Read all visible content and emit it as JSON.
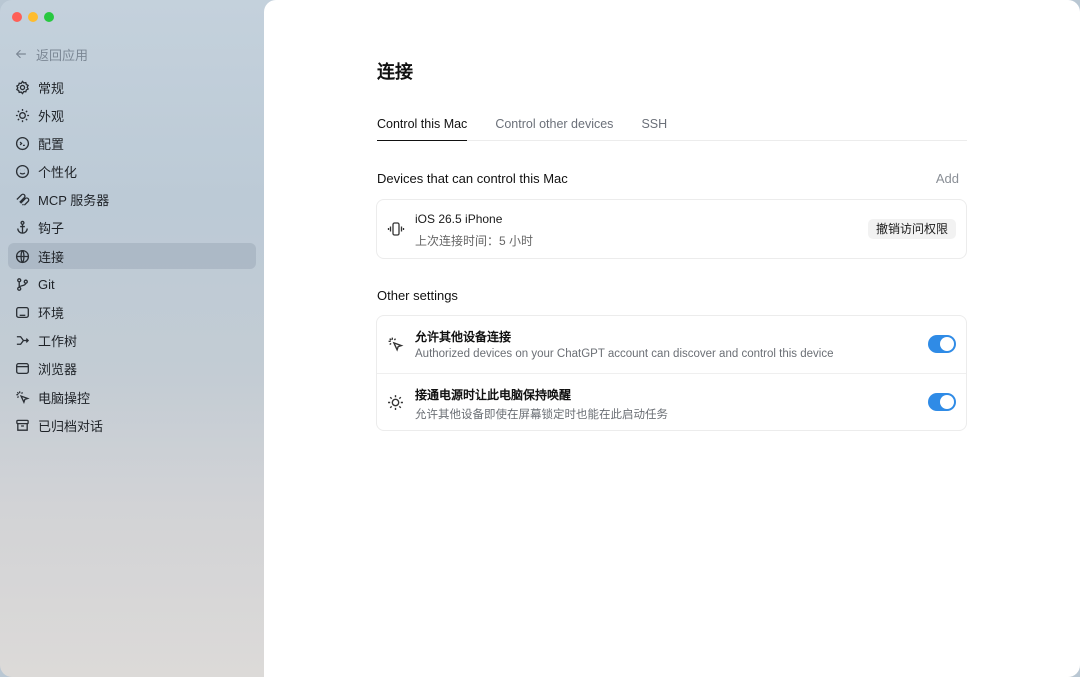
{
  "sidebar": {
    "back_label": "返回应用",
    "items": [
      {
        "label": "常规",
        "icon": "gear-icon"
      },
      {
        "label": "外观",
        "icon": "sun-icon"
      },
      {
        "label": "配置",
        "icon": "config-icon"
      },
      {
        "label": "个性化",
        "icon": "smiley-icon"
      },
      {
        "label": "MCP 服务器",
        "icon": "mcp-icon"
      },
      {
        "label": "钩子",
        "icon": "anchor-icon"
      },
      {
        "label": "连接",
        "icon": "globe-icon",
        "active": true
      },
      {
        "label": "Git",
        "icon": "git-branch-icon"
      },
      {
        "label": "环境",
        "icon": "terminal-icon"
      },
      {
        "label": "工作树",
        "icon": "worktree-icon"
      },
      {
        "label": "浏览器",
        "icon": "browser-icon"
      },
      {
        "label": "电脑操控",
        "icon": "cursor-click-icon"
      },
      {
        "label": "已归档对话",
        "icon": "archive-icon"
      }
    ]
  },
  "main": {
    "title": "连接",
    "tabs": [
      {
        "label": "Control this Mac",
        "active": true
      },
      {
        "label": "Control other devices",
        "active": false
      },
      {
        "label": "SSH",
        "active": false
      }
    ],
    "devices_section": {
      "title": "Devices that can control this Mac",
      "add_label": "Add",
      "devices": [
        {
          "name": "iOS 26.5 iPhone",
          "last_connected": "上次连接时间：5 小时",
          "revoke_label": "撤销访问权限",
          "icon": "phone-vibrate-icon"
        }
      ]
    },
    "other_section": {
      "title": "Other settings",
      "settings": [
        {
          "title": "允许其他设备连接",
          "description": "Authorized devices on your ChatGPT account can discover and control this device",
          "enabled": true,
          "icon": "cursor-click-icon"
        },
        {
          "title": "接通电源时让此电脑保持唤醒",
          "description": "允许其他设备即使在屏幕锁定时也能在此启动任务",
          "enabled": true,
          "icon": "sun-icon"
        }
      ]
    }
  },
  "colors": {
    "toggle_on": "#2f8be6",
    "active_nav": "#a9b6c3"
  }
}
